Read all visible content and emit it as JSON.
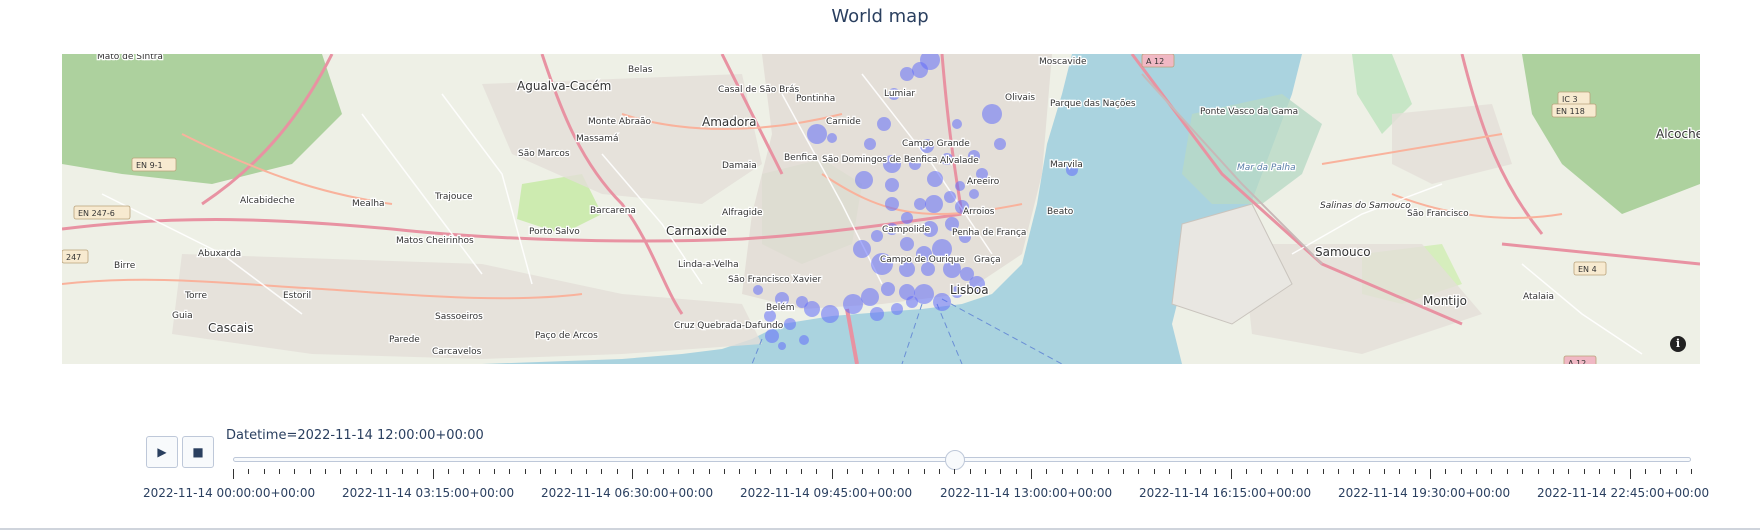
{
  "title": "World map",
  "map": {
    "attribution_icon": "info-icon",
    "bubble_color": "#636efa",
    "place_labels": [
      "Belas",
      "Moscavide",
      "Agualva-Cacém",
      "Casal de São Brás",
      "Pontinha",
      "Olivais",
      "Parque das Nações",
      "Monte Abraão",
      "Amadora",
      "Massamá",
      "Carnide",
      "Lumiar",
      "Ponte Vasco da Gama",
      "Alcochete",
      "São Marcos",
      "Damaia",
      "Benfica",
      "São Domingos de Benfica",
      "Campo Grande",
      "Alvalade",
      "Marvila",
      "Mar da Palha",
      "Areeiro",
      "Alcabideche",
      "Mealha",
      "Trajouce",
      "Barcarena",
      "Alfragide",
      "Arroios",
      "Beato",
      "Matos Cheirinhos",
      "Porto Salvo",
      "Carnaxide",
      "Campolide",
      "Penha de França",
      "Salinas do Samouco",
      "São Francisco",
      "Birre",
      "Abuxarda",
      "Linda-a-Velha",
      "São Francisco Xavier",
      "Campo de Ourique",
      "Graça",
      "Samouco",
      "Torre",
      "Estoril",
      "Cruz Quebrada-Dafundo",
      "Lisboa",
      "Belém",
      "Montijo",
      "Atalaia",
      "Guia",
      "Cascais",
      "Sassoeiros",
      "Paço de Arcos",
      "Parede",
      "Carcavelos",
      "Mato de Sintra"
    ],
    "road_shields": [
      "A 12",
      "IC 3",
      "EN 118",
      "EN 9-1",
      "EN 247-6",
      "247",
      "EN 4",
      "A 12"
    ]
  },
  "controls": {
    "play_icon": "▶",
    "stop_icon": "■",
    "current_value_prefix": "Datetime=",
    "current_value": "2022-11-14 12:00:00+00:00",
    "position_fraction": 0.5
  },
  "slider": {
    "tick_labels": [
      "2022-11-14 00:00:00+00:00",
      "2022-11-14 03:15:00+00:00",
      "2022-11-14 06:30:00+00:00",
      "2022-11-14 09:45:00+00:00",
      "2022-11-14 13:00:00+00:00",
      "2022-11-14 16:15:00+00:00",
      "2022-11-14 19:30:00+00:00",
      "2022-11-14 22:45:00+00:00"
    ],
    "step_count": 96,
    "label_every": 13
  }
}
